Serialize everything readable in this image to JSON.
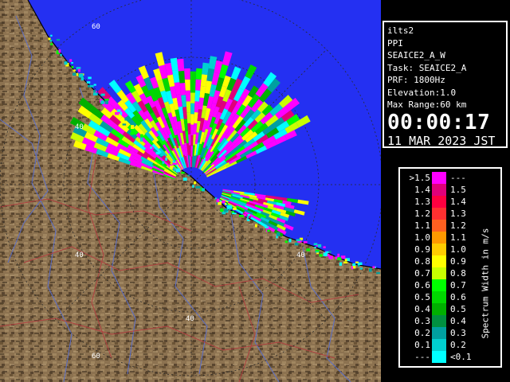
{
  "map": {
    "range_labels": {
      "ring60_top": "60",
      "ring40_left": "40",
      "ring40_right": "40",
      "ring20_left": "40",
      "ring20_bottom": "40",
      "ring60_bottom": "60"
    },
    "colors": {
      "sea": "#2430f2",
      "land": "#8c7250",
      "land_shade": "#5a4630",
      "rivers": "#5a6ec8",
      "roads": "#b04040",
      "range_rings": "#2a2a2a",
      "coast": "#000000"
    }
  },
  "info": {
    "station": "ilts2",
    "mode": "PPI",
    "scan": "SEAICE2_A_W",
    "task": "Task: SEAICE2_A",
    "prf": "PRF: 1800Hz",
    "elevation": "Elevation:1.0",
    "max_range": "Max Range:60 km",
    "time": "00:00:17",
    "date": "11 MAR 2023 JST"
  },
  "legend": {
    "unit_label": "Spectrum Width in m/s",
    "rows": [
      {
        "left": ">1.5",
        "right": "---",
        "color": "#ff00ff"
      },
      {
        "left": "1.4",
        "right": "1.5",
        "color": "#e0007a"
      },
      {
        "left": "1.3",
        "right": "1.4",
        "color": "#ff0040"
      },
      {
        "left": "1.2",
        "right": "1.3",
        "color": "#ff3030"
      },
      {
        "left": "1.1",
        "right": "1.2",
        "color": "#ff6020"
      },
      {
        "left": "1.0",
        "right": "1.1",
        "color": "#ff9900"
      },
      {
        "left": "0.9",
        "right": "1.0",
        "color": "#ffcc00"
      },
      {
        "left": "0.8",
        "right": "0.9",
        "color": "#ffff00"
      },
      {
        "left": "0.7",
        "right": "0.8",
        "color": "#c8ff00"
      },
      {
        "left": "0.6",
        "right": "0.7",
        "color": "#00ff00"
      },
      {
        "left": "0.5",
        "right": "0.6",
        "color": "#00d800"
      },
      {
        "left": "0.4",
        "right": "0.5",
        "color": "#00b000"
      },
      {
        "left": "0.3",
        "right": "0.4",
        "color": "#009040"
      },
      {
        "left": "0.2",
        "right": "0.3",
        "color": "#00a0a0"
      },
      {
        "left": "0.1",
        "right": "0.2",
        "color": "#00d0d0"
      },
      {
        "left": "---",
        "right": "<0.1",
        "color": "#00ffff"
      }
    ]
  }
}
